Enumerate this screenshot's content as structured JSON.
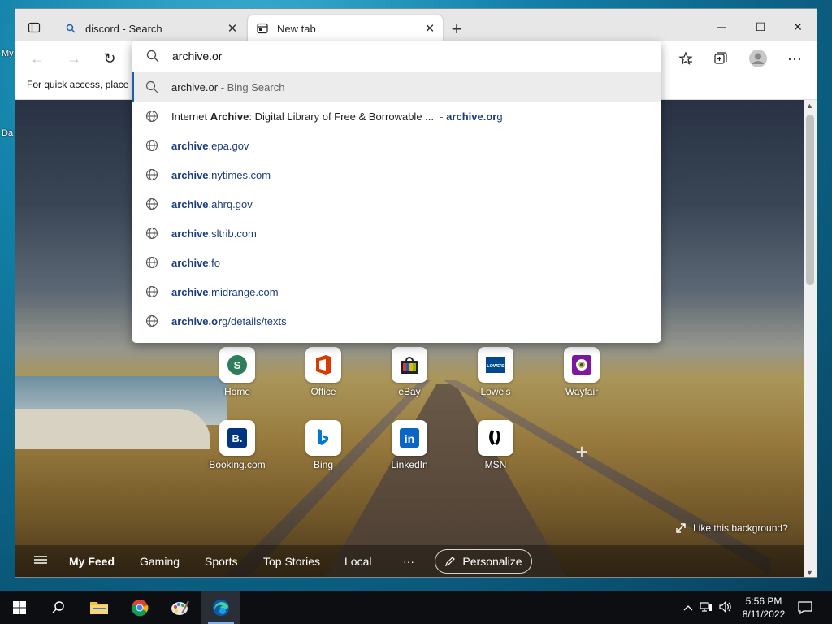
{
  "desktop": {
    "labels": [
      "My",
      "Da"
    ]
  },
  "browser": {
    "tabs": [
      {
        "label": "discord - Search",
        "icon": "search-icon"
      },
      {
        "label": "New tab",
        "icon": "newtab-icon"
      }
    ],
    "new_tab": "+",
    "window_controls": {
      "minimize": "─",
      "maximize": "☐",
      "close": "✕"
    },
    "toolbar": {
      "back": "←",
      "forward": "→",
      "refresh": "↻",
      "more": "···"
    },
    "favbar_text": "For quick access, place y"
  },
  "omnibox": {
    "value": "archive.or",
    "suggestions": [
      {
        "type": "search",
        "parts": [
          {
            "t": "archive.or",
            "c": ""
          },
          {
            "t": " - Bing Search",
            "c": "dim"
          }
        ]
      },
      {
        "type": "site",
        "parts": [
          {
            "t": "Internet ",
            "c": ""
          },
          {
            "t": "Archive",
            "c": "b"
          },
          {
            "t": ": Digital Library of Free & Borrowable ...",
            "c": ""
          },
          {
            "t": "  - ",
            "c": "dim"
          },
          {
            "t": "archive.or",
            "c": "b link"
          },
          {
            "t": "g",
            "c": "link"
          }
        ]
      },
      {
        "type": "site",
        "parts": [
          {
            "t": "archive",
            "c": "b link"
          },
          {
            "t": ".epa.gov",
            "c": "link"
          }
        ]
      },
      {
        "type": "site",
        "parts": [
          {
            "t": "archive",
            "c": "b link"
          },
          {
            "t": ".nytimes.com",
            "c": "link"
          }
        ]
      },
      {
        "type": "site",
        "parts": [
          {
            "t": "archive",
            "c": "b link"
          },
          {
            "t": ".ahrq.gov",
            "c": "link"
          }
        ]
      },
      {
        "type": "site",
        "parts": [
          {
            "t": "archive",
            "c": "b link"
          },
          {
            "t": ".sltrib.com",
            "c": "link"
          }
        ]
      },
      {
        "type": "site",
        "parts": [
          {
            "t": "archive",
            "c": "b link"
          },
          {
            "t": ".fo",
            "c": "link"
          }
        ]
      },
      {
        "type": "site",
        "parts": [
          {
            "t": "archive",
            "c": "b link"
          },
          {
            "t": ".midrange.com",
            "c": "link"
          }
        ]
      },
      {
        "type": "site",
        "parts": [
          {
            "t": "archive.or",
            "c": "b link"
          },
          {
            "t": "g/details/texts",
            "c": "link"
          }
        ]
      }
    ]
  },
  "tiles": [
    {
      "name": "Home",
      "icon": "home-s-icon",
      "glyph": "S",
      "color": "#2e7d5b"
    },
    {
      "name": "Office",
      "icon": "office-icon",
      "glyph": "O",
      "color": "#d83b01"
    },
    {
      "name": "eBay",
      "icon": "ebay-icon",
      "glyph": "",
      "color": "#e53238"
    },
    {
      "name": "Lowe's",
      "icon": "lowes-icon",
      "glyph": "LOWE'S",
      "color": "#004990"
    },
    {
      "name": "Wayfair",
      "icon": "wayfair-icon",
      "glyph": "",
      "color": "#7b189f"
    },
    {
      "name": "Booking.com",
      "icon": "booking-icon",
      "glyph": "B.",
      "color": "#003580"
    },
    {
      "name": "Bing",
      "icon": "bing-icon",
      "glyph": "b",
      "color": "#0078d4"
    },
    {
      "name": "LinkedIn",
      "icon": "linkedin-icon",
      "glyph": "in",
      "color": "#0a66c2"
    },
    {
      "name": "MSN",
      "icon": "msn-icon",
      "glyph": "",
      "color": "#000000"
    }
  ],
  "ntp": {
    "like_bg": "Like this background?",
    "feed": [
      "My Feed",
      "Gaming",
      "Sports",
      "Top Stories",
      "Local",
      "···"
    ],
    "personalize": "Personalize"
  },
  "taskbar": {
    "time": "5:56 PM",
    "date": "8/11/2022"
  }
}
